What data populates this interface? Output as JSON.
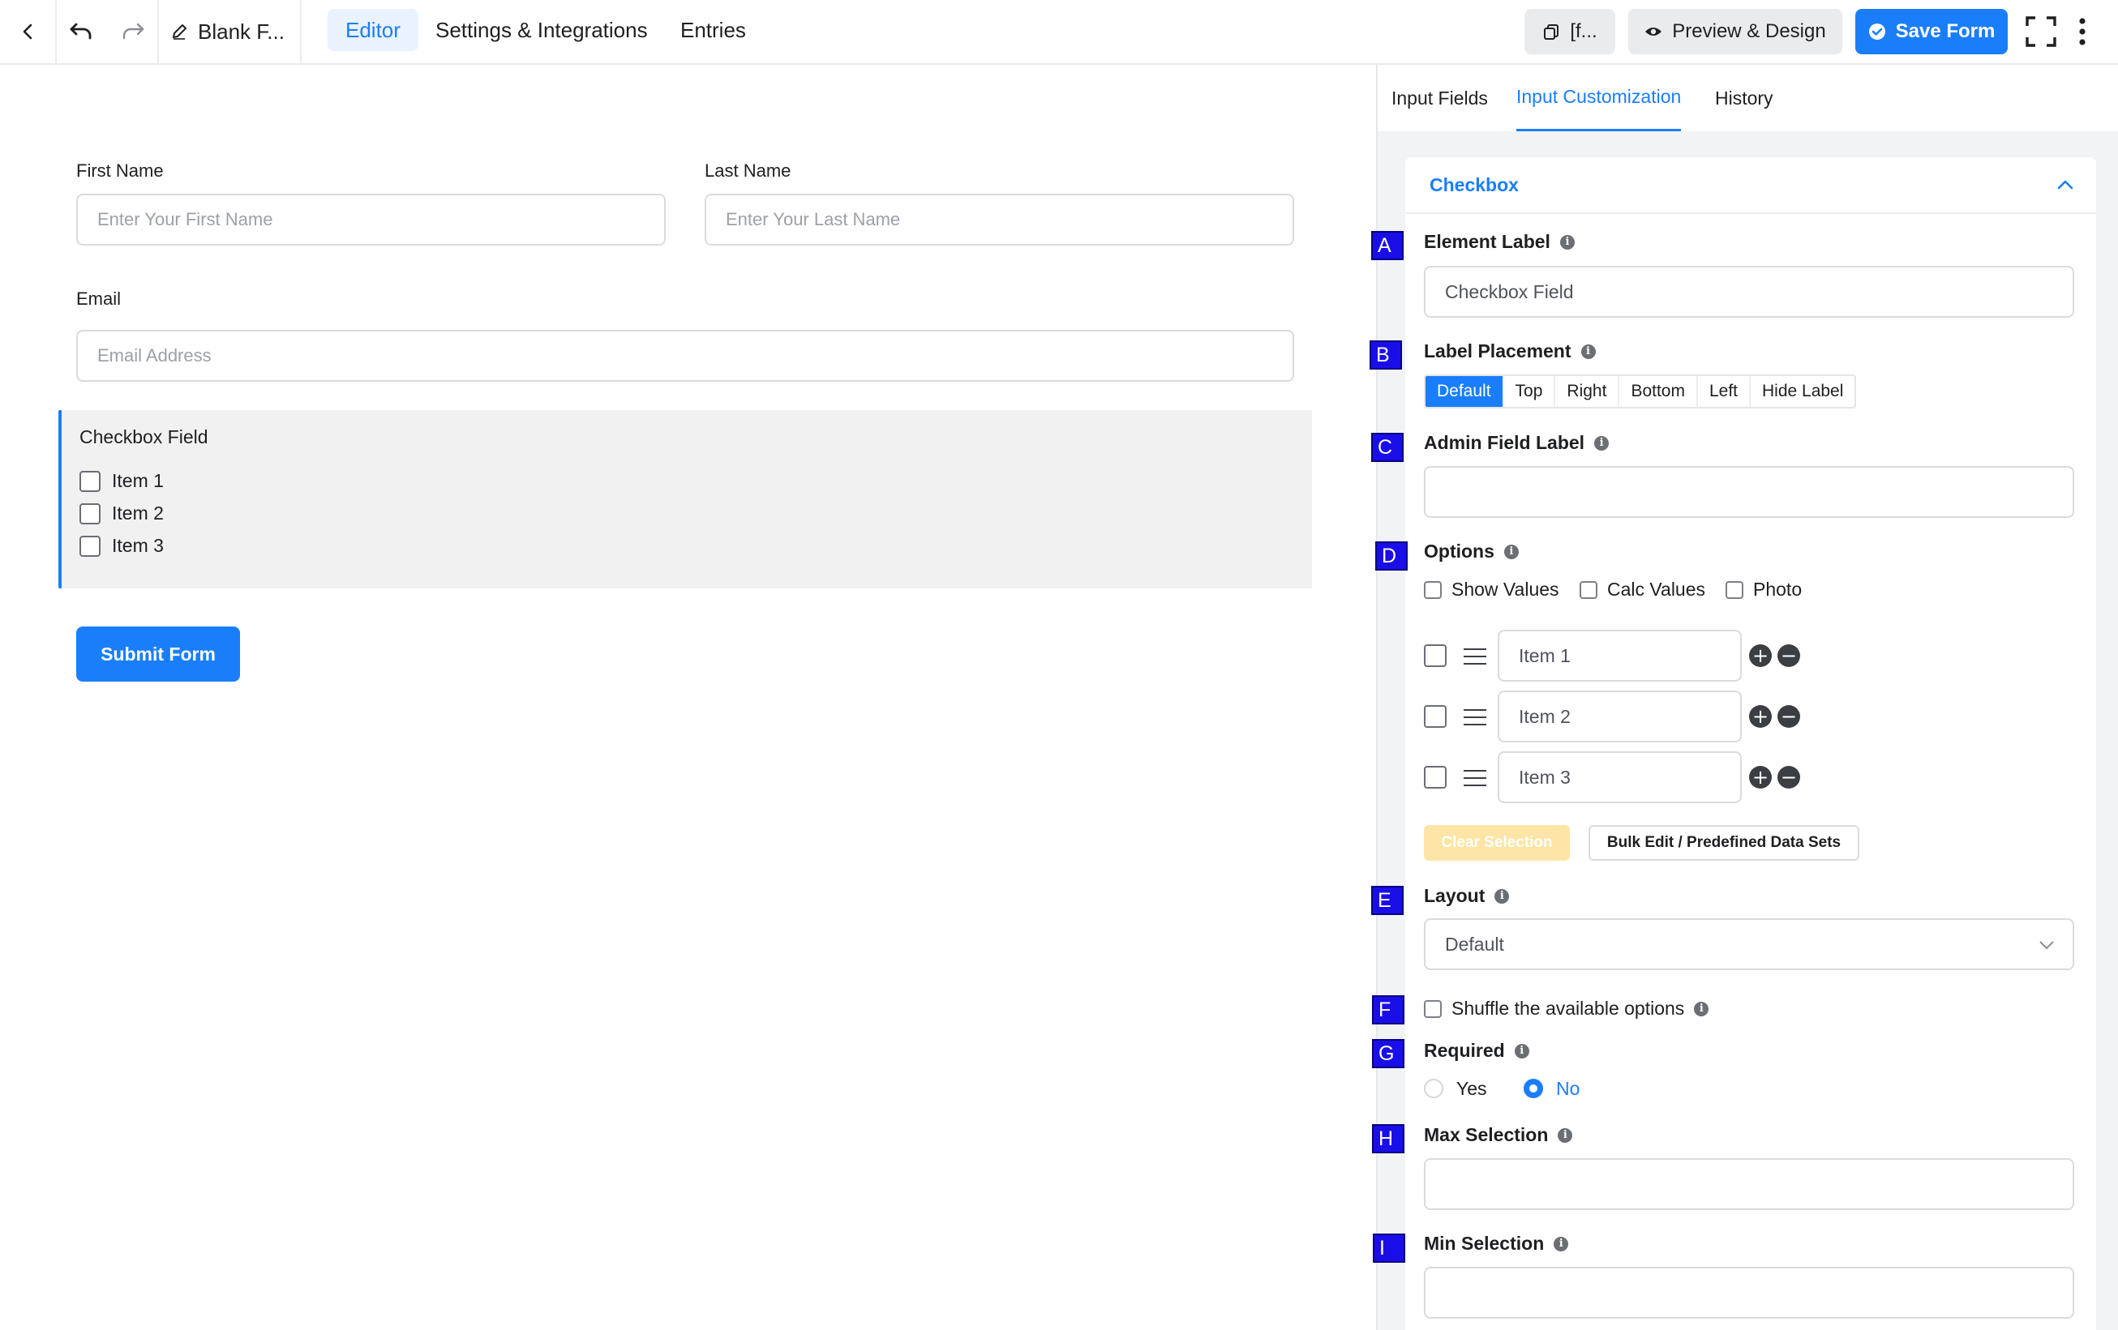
{
  "topbar": {
    "form_title": "Blank F...",
    "tabs": [
      {
        "label": "Editor"
      },
      {
        "label": "Settings & Integrations"
      },
      {
        "label": "Entries"
      }
    ],
    "shortcode_label": "[f...",
    "preview_label": "Preview & Design",
    "save_label": "Save Form"
  },
  "form": {
    "first_name": {
      "label": "First Name",
      "placeholder": "Enter Your First Name"
    },
    "last_name": {
      "label": "Last Name",
      "placeholder": "Enter Your Last Name"
    },
    "email": {
      "label": "Email",
      "placeholder": "Email Address"
    },
    "checkbox": {
      "label": "Checkbox Field",
      "items": [
        "Item 1",
        "Item 2",
        "Item 3"
      ]
    },
    "submit_label": "Submit Form"
  },
  "panel": {
    "tabs": [
      {
        "label": "Input Fields"
      },
      {
        "label": "Input Customization"
      },
      {
        "label": "History"
      }
    ],
    "section_title": "Checkbox",
    "element_label": {
      "marker": "A",
      "title": "Element Label",
      "value": "Checkbox Field"
    },
    "label_placement": {
      "marker": "B",
      "title": "Label Placement",
      "options": [
        "Default",
        "Top",
        "Right",
        "Bottom",
        "Left",
        "Hide Label"
      ],
      "selected": "Default"
    },
    "admin_field_label": {
      "marker": "C",
      "title": "Admin Field Label",
      "value": ""
    },
    "options": {
      "marker": "D",
      "title": "Options",
      "toggles": [
        "Show Values",
        "Calc Values",
        "Photo"
      ],
      "items": [
        "Item 1",
        "Item 2",
        "Item 3"
      ],
      "clear_label": "Clear Selection",
      "bulk_label": "Bulk Edit / Predefined Data Sets"
    },
    "layout": {
      "marker": "E",
      "title": "Layout",
      "value": "Default"
    },
    "shuffle": {
      "marker": "F",
      "label": "Shuffle the available options"
    },
    "required": {
      "marker": "G",
      "title": "Required",
      "yes": "Yes",
      "no": "No",
      "selected": "No"
    },
    "max_selection": {
      "marker": "H",
      "title": "Max Selection",
      "value": ""
    },
    "min_selection": {
      "marker": "I",
      "title": "Min Selection",
      "value": ""
    }
  },
  "colors": {
    "accent": "#1a7efb",
    "marker": "#1a0ee8",
    "clear_button": "#fce5a6"
  }
}
